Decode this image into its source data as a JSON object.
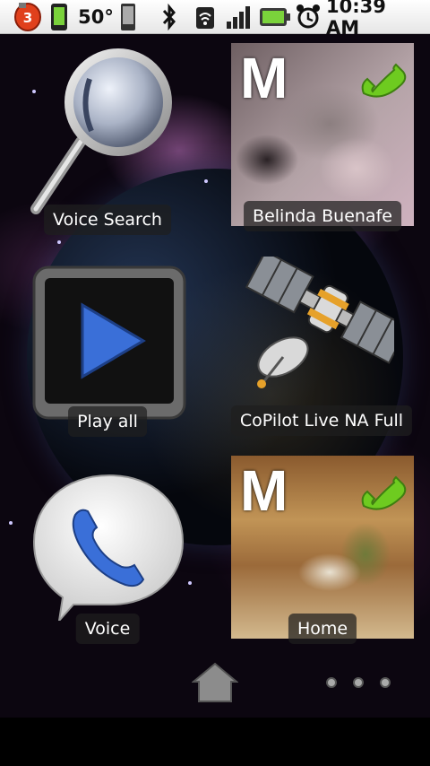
{
  "status_bar": {
    "notification_count": "3",
    "signal_text": "50°",
    "time": "10:39 AM",
    "icons": [
      "notification-badge-icon",
      "battery-phone-icon",
      "device-icon",
      "bluetooth-icon",
      "wifi-icon",
      "cell-signal-icon",
      "battery-icon",
      "alarm-clock-icon"
    ]
  },
  "shortcuts": {
    "voice_search": {
      "label": "Voice Search",
      "icon": "magnifier-icon"
    },
    "belinda": {
      "label": "Belinda Buenafe",
      "letter": "M",
      "icon": "phone-icon"
    },
    "play_all": {
      "label": "Play all",
      "icon": "play-icon"
    },
    "copilot": {
      "label": "CoPilot Live NA Full",
      "icon": "satellite-icon"
    },
    "voice": {
      "label": "Voice",
      "icon": "voice-phone-bubble-icon"
    },
    "home": {
      "label": "Home",
      "letter": "M",
      "icon": "phone-icon"
    }
  },
  "dock": {
    "home_button": "home-icon",
    "page_dots": 3
  },
  "colors": {
    "accent_green": "#6ecb20",
    "play_blue": "#3a6fd8",
    "badge_red": "#e0401c"
  }
}
